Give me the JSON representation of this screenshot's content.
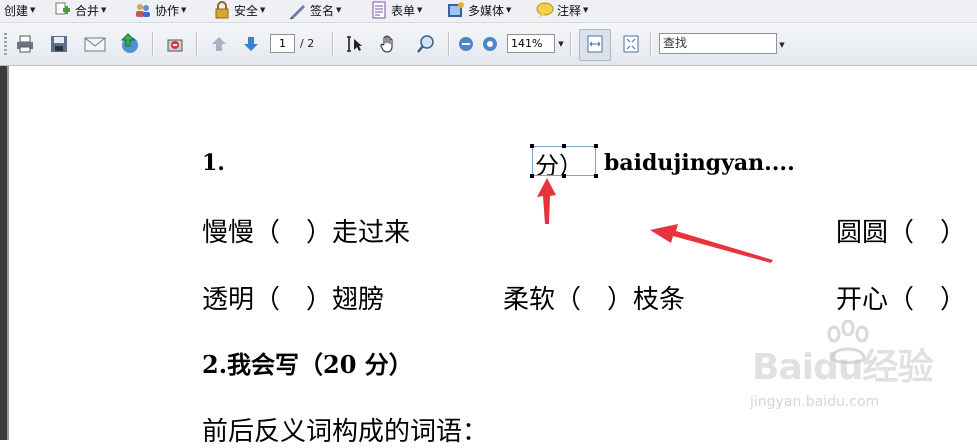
{
  "menubar": {
    "items": [
      {
        "label": "创建",
        "icon": "create-icon"
      },
      {
        "label": "合并",
        "icon": "combine-plus-icon"
      },
      {
        "label": "协作",
        "icon": "collaborate-people-icon"
      },
      {
        "label": "安全",
        "icon": "lock-icon"
      },
      {
        "label": "签名",
        "icon": "pen-sign-icon"
      },
      {
        "label": "表单",
        "icon": "form-icon"
      },
      {
        "label": "多媒体",
        "icon": "film-icon"
      },
      {
        "label": "注释",
        "icon": "comment-bubble-icon"
      }
    ]
  },
  "toolbar": {
    "page_current": "1",
    "page_total": "/ 2",
    "zoom": "141%",
    "search_placeholder": "查找"
  },
  "document": {
    "line1_num": "1.",
    "line1_selected": "分）",
    "line1_tail": "baidujingyan....",
    "row1_left": "慢慢（　）走过来",
    "row1_right": "圆圆（　）",
    "row2_left": "透明（　）翅膀",
    "row2_mid": "柔软（　）枝条",
    "row2_right": "开心（　）",
    "heading2": "2.我会写（20 分）",
    "line_last": "前后反义词构成的词语："
  },
  "watermark": {
    "brand": "Baidu经验",
    "url": "jingyan.baidu.com"
  },
  "colors": {
    "annotation_arrow": "#e8323c",
    "selection_border": "#7aa3d4"
  }
}
